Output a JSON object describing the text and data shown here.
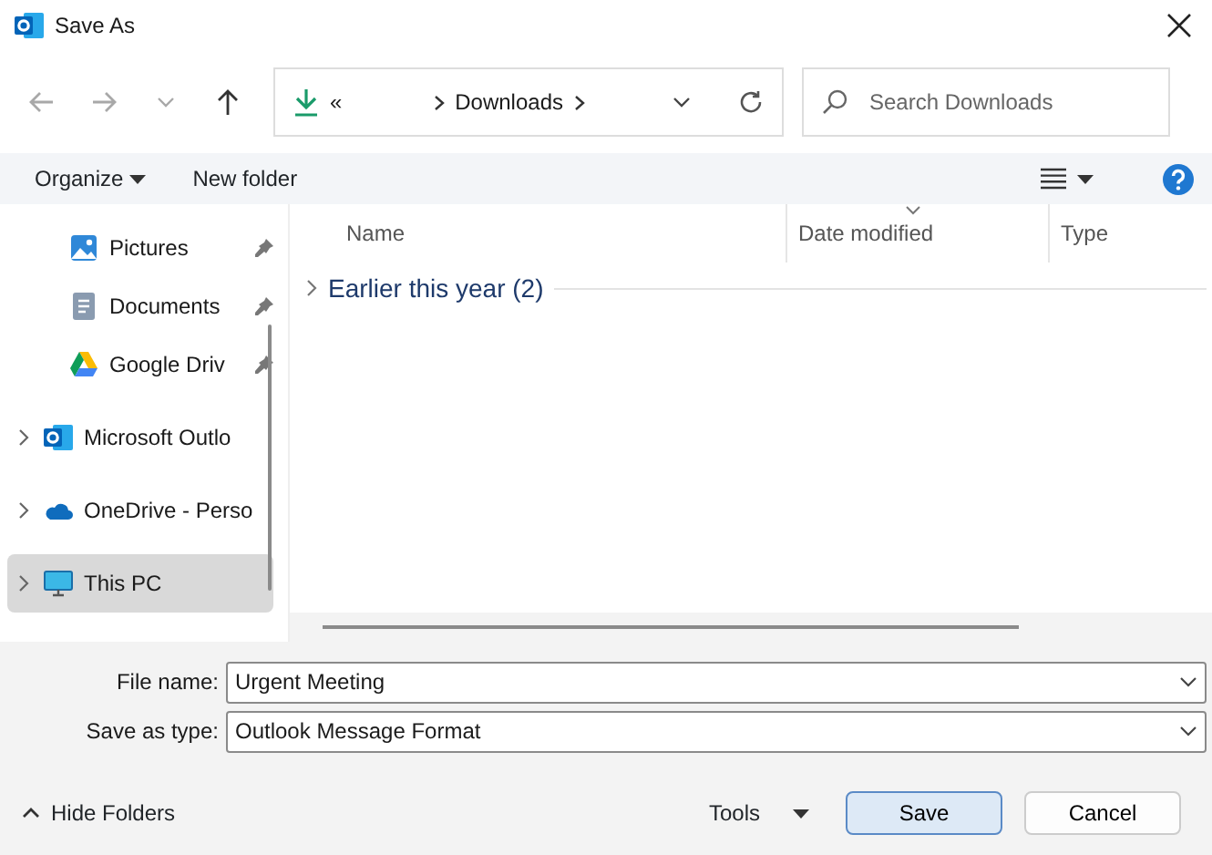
{
  "window": {
    "title": "Save As"
  },
  "nav_buttons": [
    {
      "kind": "back",
      "disabled": true
    },
    {
      "kind": "forward",
      "disabled": true
    },
    {
      "kind": "recent",
      "disabled": true
    },
    {
      "kind": "up",
      "disabled": false
    }
  ],
  "address_bar": {
    "overflow": "«",
    "segments": [
      "Downloads"
    ]
  },
  "search": {
    "placeholder": "Search Downloads"
  },
  "toolbar": {
    "organize": "Organize",
    "new_folder": "New folder"
  },
  "sidebar": {
    "items": [
      {
        "label": "Pictures",
        "kind": "pictures",
        "pinned": true,
        "expandable": false,
        "selected": false
      },
      {
        "label": "Documents",
        "kind": "documents",
        "pinned": true,
        "expandable": false,
        "selected": false
      },
      {
        "label": "Google Driv",
        "kind": "drive",
        "pinned": true,
        "expandable": false,
        "selected": false
      },
      {
        "label": "Microsoft Outlo",
        "kind": "outlook",
        "pinned": false,
        "expandable": true,
        "selected": false
      },
      {
        "label": "OneDrive - Perso",
        "kind": "cloud",
        "pinned": false,
        "expandable": true,
        "selected": false
      },
      {
        "label": "This PC",
        "kind": "pc",
        "pinned": false,
        "expandable": true,
        "selected": true
      }
    ]
  },
  "file_list": {
    "columns": [
      {
        "label": "Name",
        "sorted": false
      },
      {
        "label": "Date modified",
        "sorted": true
      },
      {
        "label": "Type",
        "sorted": false
      }
    ],
    "groups": [
      {
        "label": "Earlier this year (2)",
        "expanded": false
      }
    ]
  },
  "form": {
    "file_name_label": "File name:",
    "file_name": "Urgent Meeting",
    "type_label": "Save as type:",
    "type": "Outlook Message Format"
  },
  "footer": {
    "hide_folders": "Hide Folders",
    "tools": "Tools",
    "save": "Save",
    "cancel": "Cancel"
  }
}
